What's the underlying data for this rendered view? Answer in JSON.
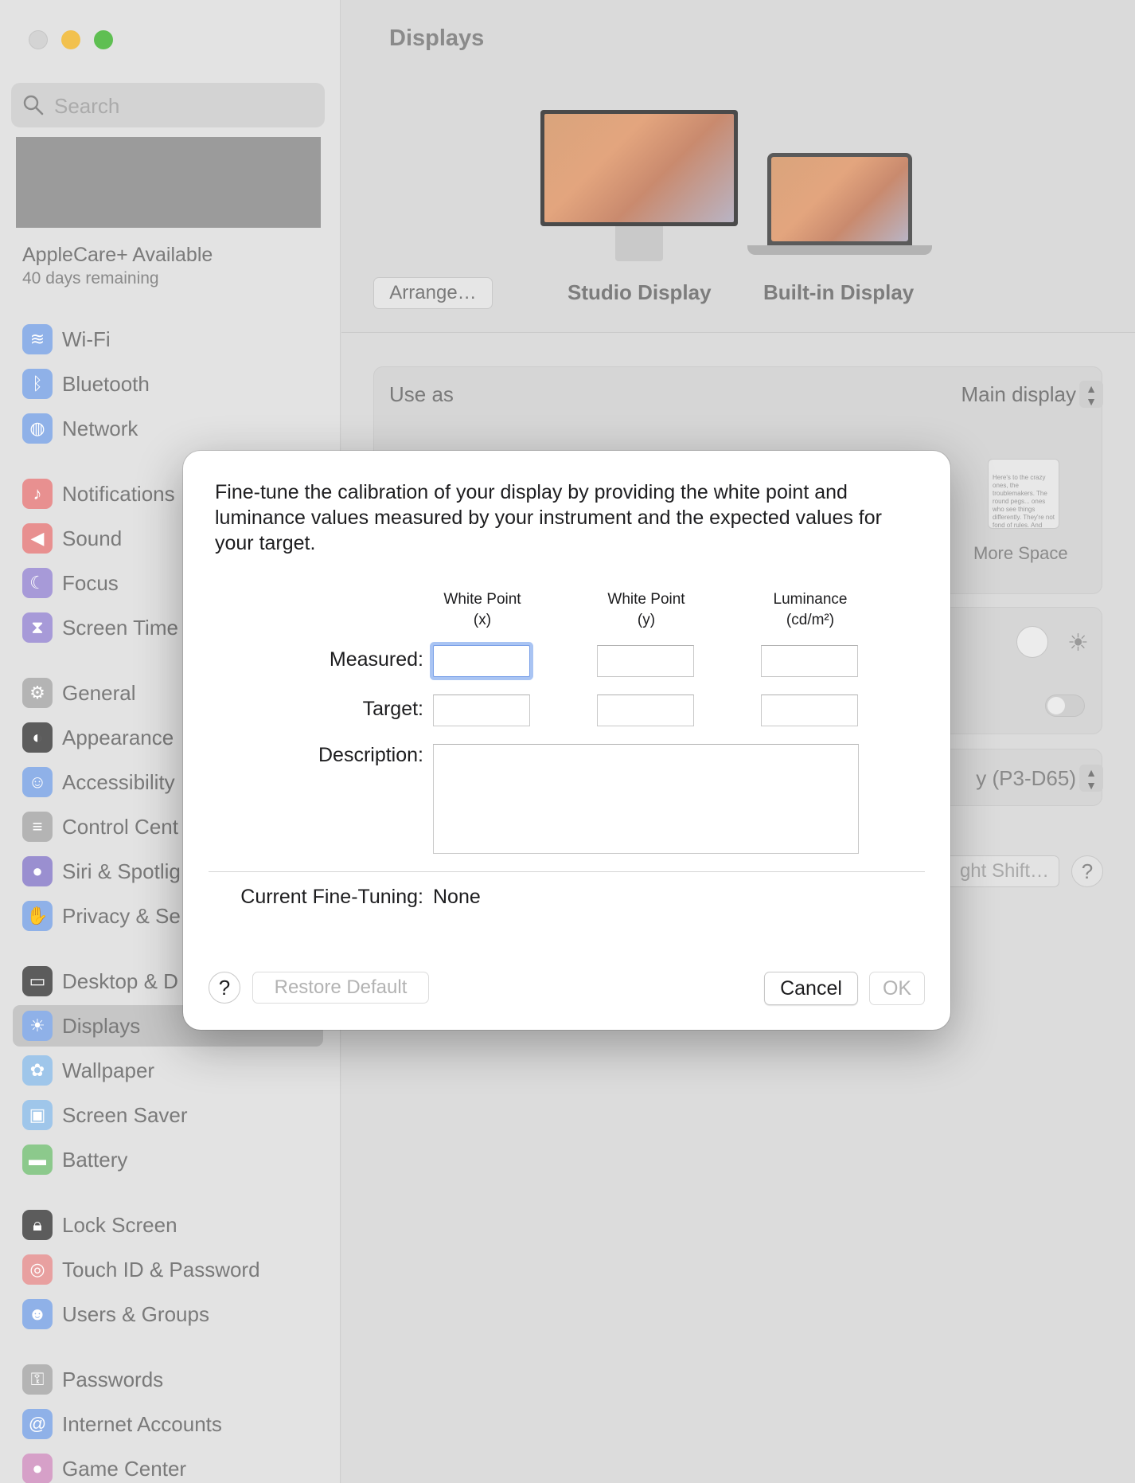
{
  "window": {
    "title": "Displays"
  },
  "sidebar": {
    "search_placeholder": "Search",
    "applecare_title": "AppleCare+ Available",
    "applecare_subtitle": "40 days remaining",
    "items": [
      {
        "label": "Wi-Fi",
        "icon": "wifi-icon",
        "color": "#8fb1e8"
      },
      {
        "label": "Bluetooth",
        "icon": "bluetooth-icon",
        "color": "#8fb1e8"
      },
      {
        "label": "Network",
        "icon": "globe-icon",
        "color": "#8fb1e8"
      },
      {
        "label": "Notifications",
        "icon": "bell-icon",
        "color": "#e89090"
      },
      {
        "label": "Sound",
        "icon": "speaker-icon",
        "color": "#e89090"
      },
      {
        "label": "Focus",
        "icon": "moon-icon",
        "color": "#a79ad8"
      },
      {
        "label": "Screen Time",
        "icon": "hourglass-icon",
        "color": "#a79ad8"
      },
      {
        "label": "General",
        "icon": "gear-icon",
        "color": "#b4b4b4"
      },
      {
        "label": "Appearance",
        "icon": "appearance-icon",
        "color": "#5c5c5c"
      },
      {
        "label": "Accessibility",
        "icon": "accessibility-icon",
        "color": "#8fb1e8"
      },
      {
        "label": "Control Cent",
        "icon": "control-center-icon",
        "color": "#b4b4b4"
      },
      {
        "label": "Siri & Spotlig",
        "icon": "siri-icon",
        "color": "#9a8fd0"
      },
      {
        "label": "Privacy & Se",
        "icon": "hand-icon",
        "color": "#8fb1e8"
      },
      {
        "label": "Desktop & D",
        "icon": "desktop-icon",
        "color": "#5c5c5c"
      },
      {
        "label": "Displays",
        "icon": "sun-icon",
        "color": "#8fb1e8"
      },
      {
        "label": "Wallpaper",
        "icon": "flower-icon",
        "color": "#9fc6ea"
      },
      {
        "label": "Screen Saver",
        "icon": "screen-saver-icon",
        "color": "#9fc6ea"
      },
      {
        "label": "Battery",
        "icon": "battery-icon",
        "color": "#8cc98c"
      },
      {
        "label": "Lock Screen",
        "icon": "lock-icon",
        "color": "#5c5c5c"
      },
      {
        "label": "Touch ID & Password",
        "icon": "fingerprint-icon",
        "color": "#e8a0a0"
      },
      {
        "label": "Users & Groups",
        "icon": "users-icon",
        "color": "#8fb1e8"
      },
      {
        "label": "Passwords",
        "icon": "key-icon",
        "color": "#b4b4b4"
      },
      {
        "label": "Internet Accounts",
        "icon": "at-icon",
        "color": "#8fb1e8"
      },
      {
        "label": "Game Center",
        "icon": "game-center-icon",
        "color": "#d6a0c8"
      }
    ]
  },
  "main": {
    "arrange_label": "Arrange…",
    "displays": [
      {
        "label": "Studio Display"
      },
      {
        "label": "Built-in Display"
      }
    ],
    "use_as_label": "Use as",
    "use_as_value": "Main display",
    "more_space_label": "More Space",
    "more_space_thumb_text": "Here's to the crazy ones, the troublemakers. The round pegs... ones who see things differently. They're not fond of rules. And they have no respect for the status quo. You can quote them, disagree with them. About the only thing you can't do is ignore them. Because they change things.",
    "color_profile_value": "y (P3-D65)",
    "night_shift_label": "ght Shift…",
    "help_label": "?"
  },
  "dialog": {
    "intro": "Fine-tune the calibration of your display by providing the white point and luminance values measured by your instrument and the expected values for your target.",
    "columns": [
      {
        "line1": "White Point",
        "line2": "(x)"
      },
      {
        "line1": "White Point",
        "line2": "(y)"
      },
      {
        "line1": "Luminance",
        "line2": "(cd/m²)"
      }
    ],
    "rows": {
      "measured_label": "Measured:",
      "target_label": "Target:",
      "description_label": "Description:"
    },
    "current_fine_tuning_label": "Current Fine-Tuning:",
    "current_fine_tuning_value": "None",
    "help_label": "?",
    "restore_default_label": "Restore Default",
    "cancel_label": "Cancel",
    "ok_label": "OK"
  }
}
